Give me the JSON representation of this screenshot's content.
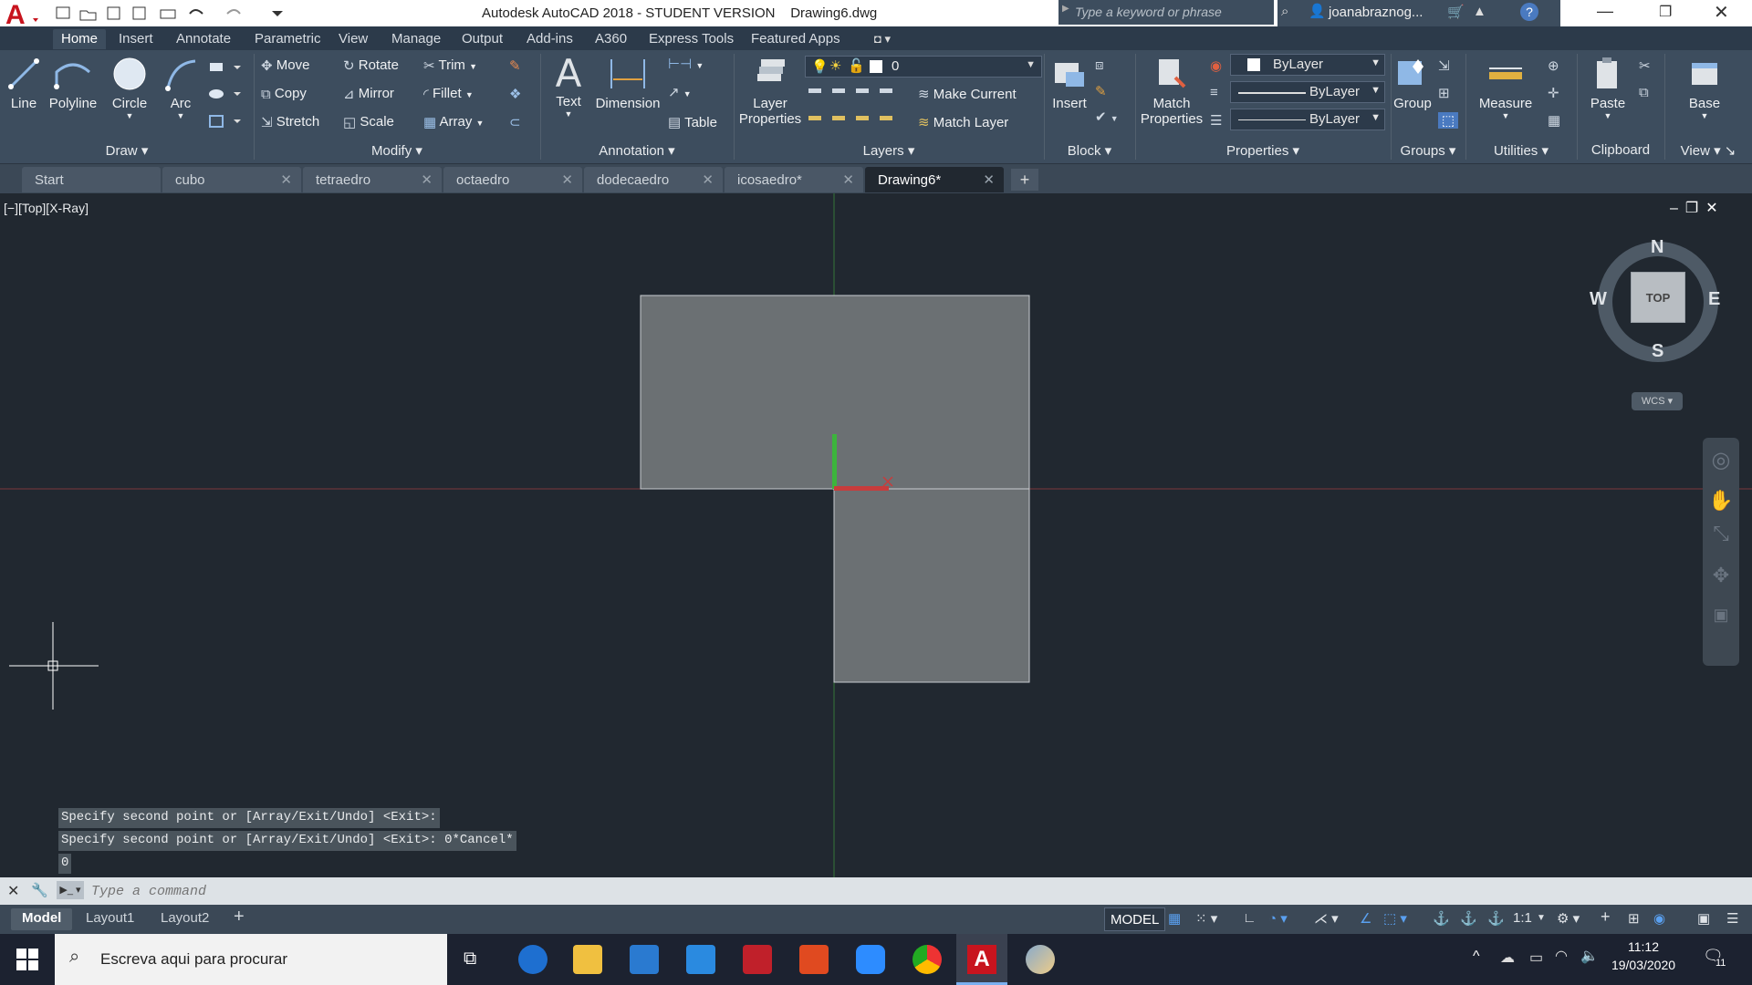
{
  "titlebar": {
    "app_title": "Autodesk AutoCAD 2018 - STUDENT VERSION",
    "file_name": "Drawing6.dwg",
    "search_placeholder": "Type a keyword or phrase",
    "user_name": "joanabraznog...",
    "app_logo": "A"
  },
  "ribbon_tabs": [
    "Home",
    "Insert",
    "Annotate",
    "Parametric",
    "View",
    "Manage",
    "Output",
    "Add-ins",
    "A360",
    "Express Tools",
    "Featured Apps"
  ],
  "ribbon": {
    "draw": {
      "line": "Line",
      "polyline": "Polyline",
      "circle": "Circle",
      "arc": "Arc",
      "title": "Draw"
    },
    "modify": {
      "move": "Move",
      "rotate": "Rotate",
      "trim": "Trim",
      "copy": "Copy",
      "mirror": "Mirror",
      "fillet": "Fillet",
      "stretch": "Stretch",
      "scale": "Scale",
      "array": "Array",
      "title": "Modify"
    },
    "annotation": {
      "text": "Text",
      "dimension": "Dimension",
      "table": "Table",
      "title": "Annotation"
    },
    "layers": {
      "layer_properties_1": "Layer",
      "layer_properties_2": "Properties",
      "current_layer": "0",
      "make_current": "Make Current",
      "match_layer": "Match Layer",
      "title": "Layers"
    },
    "block": {
      "insert": "Insert",
      "title": "Block"
    },
    "properties": {
      "match_1": "Match",
      "match_2": "Properties",
      "color": "ByLayer",
      "linetype": "ByLayer",
      "lineweight": "ByLayer",
      "title": "Properties"
    },
    "groups": {
      "group": "Group",
      "title": "Groups"
    },
    "utilities": {
      "measure": "Measure",
      "title": "Utilities"
    },
    "clipboard": {
      "paste": "Paste",
      "title": "Clipboard"
    },
    "view": {
      "base": "Base",
      "title": "View"
    }
  },
  "doc_tabs": [
    {
      "label": "Start",
      "active": false
    },
    {
      "label": "cubo",
      "active": false
    },
    {
      "label": "tetraedro",
      "active": false
    },
    {
      "label": "octaedro",
      "active": false
    },
    {
      "label": "dodecaedro",
      "active": false
    },
    {
      "label": "icosaedro*",
      "active": false
    },
    {
      "label": "Drawing6*",
      "active": true
    }
  ],
  "viewport": {
    "label": "[−][Top][X-Ray]",
    "viewcube": {
      "n": "N",
      "s": "S",
      "e": "E",
      "w": "W",
      "face": "TOP",
      "wcs": "WCS"
    }
  },
  "command": {
    "history": [
      "Specify second point or [Array/Exit/Undo] <Exit>:",
      "Specify second point or [Array/Exit/Undo] <Exit>: 0*Cancel*",
      "0"
    ],
    "placeholder": "Type a command"
  },
  "layout_tabs": [
    "Model",
    "Layout1",
    "Layout2"
  ],
  "status": {
    "model": "MODEL",
    "scale": "1:1"
  },
  "taskbar": {
    "search_placeholder": "Escreva aqui para procurar",
    "time": "11:12",
    "date": "19/03/2020",
    "notifications": "11"
  },
  "colors": {
    "ribbon": "#3d4d5e",
    "canvas": "#212830",
    "shape_fill": "#6b7073",
    "axis_x": "#c83c3c",
    "axis_y": "#3cb43c"
  }
}
